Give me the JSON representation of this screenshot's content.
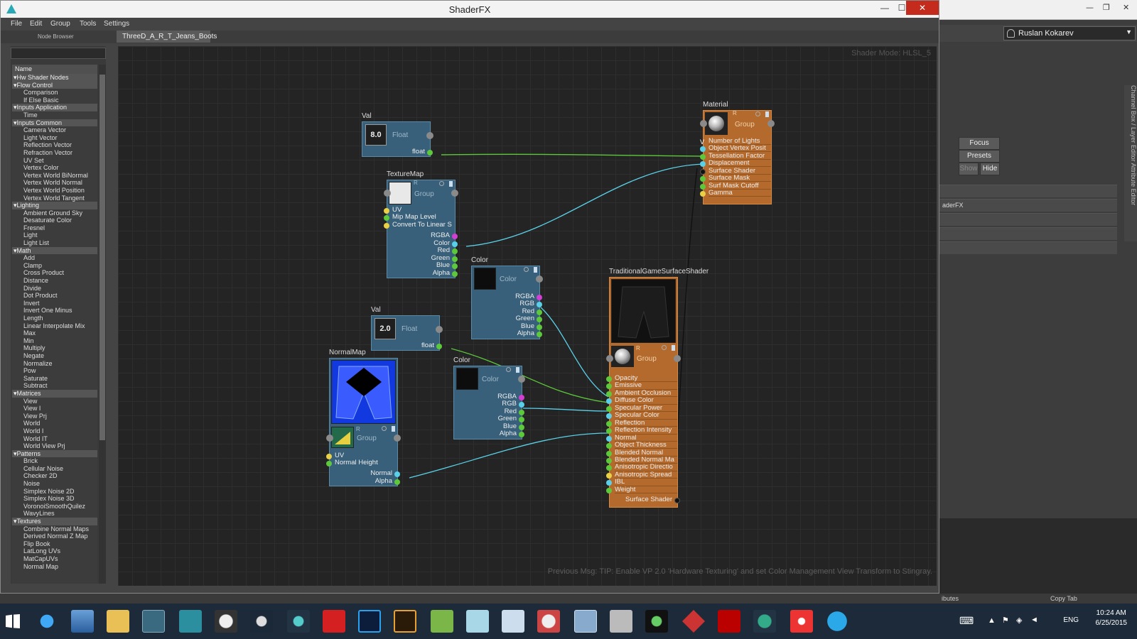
{
  "window": {
    "title": "ShaderFX",
    "min": "—",
    "max": "☐",
    "close": "✕"
  },
  "menu": [
    "File",
    "Edit",
    "Group",
    "Tools",
    "Settings"
  ],
  "node_browser": {
    "label": "Node Browser",
    "column_header": "Name",
    "items": [
      {
        "t": "cat",
        "l": "Hw Shader Nodes"
      },
      {
        "t": "cat",
        "l": "Flow Control"
      },
      {
        "t": "itm",
        "l": "Comparison"
      },
      {
        "t": "itm",
        "l": "If Else Basic"
      },
      {
        "t": "cat",
        "l": "Inputs Application"
      },
      {
        "t": "itm",
        "l": "Time"
      },
      {
        "t": "cat",
        "l": "Inputs Common"
      },
      {
        "t": "itm",
        "l": "Camera Vector"
      },
      {
        "t": "itm",
        "l": "Light Vector"
      },
      {
        "t": "itm",
        "l": "Reflection Vector"
      },
      {
        "t": "itm",
        "l": "Refraction Vector"
      },
      {
        "t": "itm",
        "l": "UV Set"
      },
      {
        "t": "itm",
        "l": "Vertex Color"
      },
      {
        "t": "itm",
        "l": "Vertex World BiNormal"
      },
      {
        "t": "itm",
        "l": "Vertex World Normal"
      },
      {
        "t": "itm",
        "l": "Vertex World Position"
      },
      {
        "t": "itm",
        "l": "Vertex World Tangent"
      },
      {
        "t": "cat",
        "l": "Lighting"
      },
      {
        "t": "itm",
        "l": "Ambient Ground Sky"
      },
      {
        "t": "itm",
        "l": "Desaturate Color"
      },
      {
        "t": "itm",
        "l": "Fresnel"
      },
      {
        "t": "itm",
        "l": "Light"
      },
      {
        "t": "itm",
        "l": "Light List"
      },
      {
        "t": "cat",
        "l": "Math"
      },
      {
        "t": "itm",
        "l": "Add"
      },
      {
        "t": "itm",
        "l": "Clamp"
      },
      {
        "t": "itm",
        "l": "Cross Product"
      },
      {
        "t": "itm",
        "l": "Distance"
      },
      {
        "t": "itm",
        "l": "Divide"
      },
      {
        "t": "itm",
        "l": "Dot Product"
      },
      {
        "t": "itm",
        "l": "Invert"
      },
      {
        "t": "itm",
        "l": "Invert One Minus"
      },
      {
        "t": "itm",
        "l": "Length"
      },
      {
        "t": "itm",
        "l": "Linear Interpolate Mix"
      },
      {
        "t": "itm",
        "l": "Max"
      },
      {
        "t": "itm",
        "l": "Min"
      },
      {
        "t": "itm",
        "l": "Multiply"
      },
      {
        "t": "itm",
        "l": "Negate"
      },
      {
        "t": "itm",
        "l": "Normalize"
      },
      {
        "t": "itm",
        "l": "Pow"
      },
      {
        "t": "itm",
        "l": "Saturate"
      },
      {
        "t": "itm",
        "l": "Subtract"
      },
      {
        "t": "cat",
        "l": "Matrices"
      },
      {
        "t": "itm",
        "l": "View"
      },
      {
        "t": "itm",
        "l": "View I"
      },
      {
        "t": "itm",
        "l": "View Prj"
      },
      {
        "t": "itm",
        "l": "World"
      },
      {
        "t": "itm",
        "l": "World I"
      },
      {
        "t": "itm",
        "l": "World IT"
      },
      {
        "t": "itm",
        "l": "World View Prj"
      },
      {
        "t": "cat",
        "l": "Patterns"
      },
      {
        "t": "itm",
        "l": "Brick"
      },
      {
        "t": "itm",
        "l": "Cellular Noise"
      },
      {
        "t": "itm",
        "l": "Checker 2D"
      },
      {
        "t": "itm",
        "l": "Noise"
      },
      {
        "t": "itm",
        "l": "Simplex Noise 2D"
      },
      {
        "t": "itm",
        "l": "Simplex Noise 3D"
      },
      {
        "t": "itm",
        "l": "VoronoiSmoothQuilez"
      },
      {
        "t": "itm",
        "l": "WavyLines"
      },
      {
        "t": "cat",
        "l": "Textures"
      },
      {
        "t": "itm",
        "l": "Combine Normal Maps"
      },
      {
        "t": "itm",
        "l": "Derived Normal Z Map"
      },
      {
        "t": "itm",
        "l": "Flip Book"
      },
      {
        "t": "itm",
        "l": "LatLong UVs"
      },
      {
        "t": "itm",
        "l": "MatCapUVs"
      },
      {
        "t": "itm",
        "l": "Normal Map"
      }
    ]
  },
  "graph": {
    "tab": "ThreeD_A_R_T_Jeans_Boots",
    "shader_mode": "Shader Mode: HLSL_5",
    "prev_msg": "Previous Msg: TIP: Enable VP 2.0 'Hardware Texturing' and set Color Management View Transform to Stingray."
  },
  "nodes": {
    "val1": {
      "title": "Val",
      "value": "8.0",
      "type": "Float",
      "out": "float"
    },
    "val2": {
      "title": "Val",
      "value": "2.0",
      "type": "Float",
      "out": "float"
    },
    "texmap": {
      "title": "TextureMap",
      "type": "Group",
      "r": "R",
      "inputs": [
        "UV",
        "Mip Map Level",
        "Convert To Linear S"
      ],
      "outputs": [
        "RGBA",
        "Color",
        "Red",
        "Green",
        "Blue",
        "Alpha"
      ]
    },
    "color1": {
      "title": "Color",
      "type": "Color",
      "outputs": [
        "RGBA",
        "RGB",
        "Red",
        "Green",
        "Blue",
        "Alpha"
      ]
    },
    "color2": {
      "title": "Color",
      "type": "Color",
      "outputs": [
        "RGBA",
        "RGB",
        "Red",
        "Green",
        "Blue",
        "Alpha"
      ]
    },
    "normalmap": {
      "title": "NormalMap",
      "type": "Group",
      "r": "R",
      "inputs": [
        "UV",
        "Normal Height"
      ],
      "outputs": [
        "Normal",
        "Alpha"
      ]
    },
    "material": {
      "title": "Material",
      "type": "Group",
      "r": "R",
      "inputs": [
        "Number of Lights",
        "Object Vertex Posit",
        "Tessellation Factor",
        "Displacement",
        "Surface Shader",
        "Surface Mask",
        "Surf Mask Cutoff",
        "Gamma"
      ]
    },
    "tgss": {
      "title": "TraditionalGameSurfaceShader",
      "type": "Group",
      "r": "R",
      "inputs": [
        "Opacity",
        "Emissive",
        "Ambient Occlusion",
        "Diffuse Color",
        "Specular Power",
        "Specular Color",
        "Reflection",
        "Reflection Intensity",
        "Normal",
        "Object Thickness",
        "Blended Normal",
        "Blended Normal Ma",
        "Anisotropic Directio",
        "Anisotropic Spread",
        "IBL",
        "Weight"
      ],
      "output": "Surface Shader"
    }
  },
  "maya": {
    "user": "Ruslan Kokarev",
    "focus": "Focus",
    "presets": "Presets",
    "show": "Show",
    "hide": "Hide",
    "side_tabs": "Channel Box / Layer Editor    Attribute Editor",
    "row_label": "aderFX",
    "bottom_left": "ibutes",
    "bottom_right": "Copy Tab"
  },
  "taskbar": {
    "lang": "ENG",
    "time": "10:24 AM",
    "date": "6/25/2015"
  }
}
